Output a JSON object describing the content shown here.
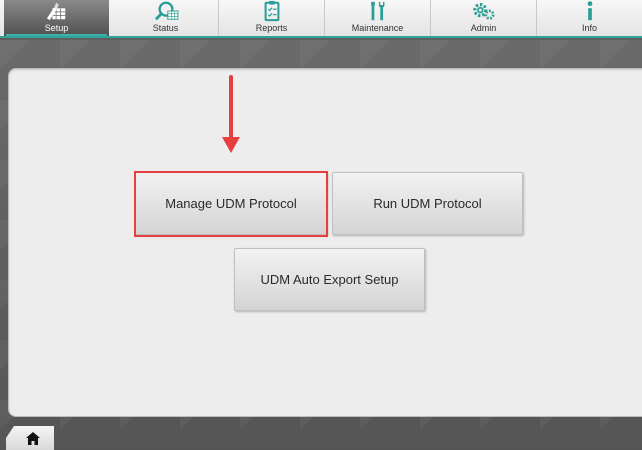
{
  "nav": {
    "tabs": [
      {
        "label": "Setup",
        "icon": "setup-icon",
        "active": true
      },
      {
        "label": "Status",
        "icon": "status-icon",
        "active": false
      },
      {
        "label": "Reports",
        "icon": "reports-icon",
        "active": false
      },
      {
        "label": "Maintenance",
        "icon": "maintenance-icon",
        "active": false
      },
      {
        "label": "Admin",
        "icon": "admin-icon",
        "active": false
      },
      {
        "label": "Info",
        "icon": "info-icon",
        "active": false
      }
    ]
  },
  "main": {
    "buttons": {
      "manage_udm_protocol": "Manage UDM Protocol",
      "run_udm_protocol": "Run UDM Protocol",
      "udm_auto_export_setup": "UDM Auto Export Setup"
    }
  },
  "footer": {
    "home_icon": "home-icon"
  },
  "colors": {
    "accent": "#2fa39b",
    "highlight": "#e5403f",
    "icon_teal": "#2a9d96"
  }
}
